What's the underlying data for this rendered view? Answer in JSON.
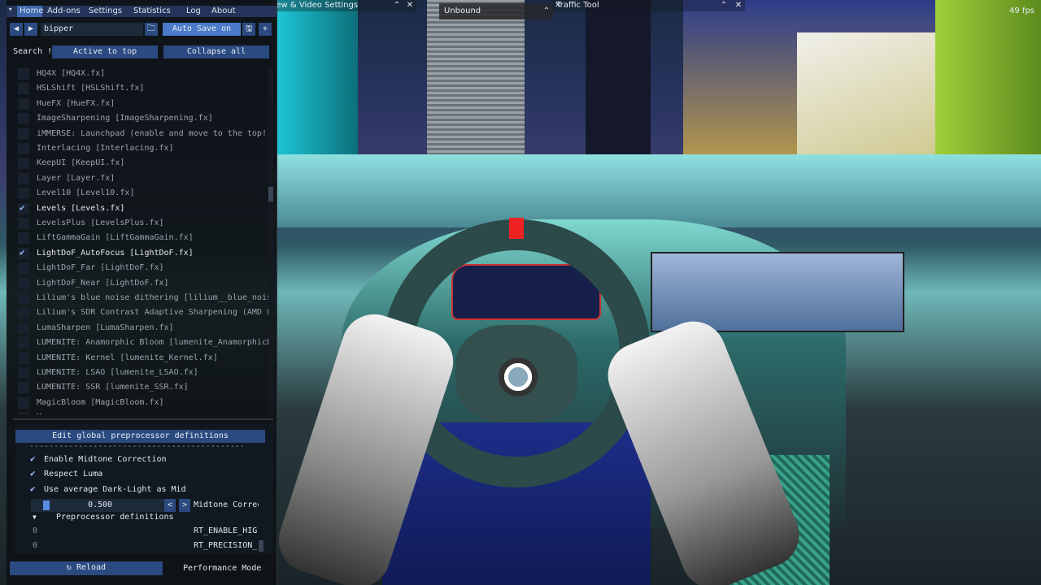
{
  "window": {
    "fps": "49 fps"
  },
  "overlays": {
    "view_video_settings": "View & Video Settings",
    "unbound": "Unbound",
    "traffic_tool": "Traffic Tool",
    "close": "✕",
    "collapse": "⌃"
  },
  "menubar": {
    "collapse_arrow": "▾",
    "items": [
      "Home",
      "Add-ons",
      "Settings",
      "Statistics",
      "Log",
      "About"
    ]
  },
  "toolbar": {
    "prev": "◀",
    "next": "▶",
    "preset_value": "bipper",
    "folder": "🗀",
    "auto_save": "Auto Save on",
    "save": "🖫",
    "add": "+"
  },
  "filter": {
    "search_label": "Search !",
    "active_to_top": "Active to top",
    "collapse_all": "Collapse all"
  },
  "effects": [
    {
      "label": "HQ4X [HQ4X.fx]",
      "checked": false
    },
    {
      "label": "HSLShift [HSLShift.fx]",
      "checked": false
    },
    {
      "label": "HueFX [HueFX.fx]",
      "checked": false
    },
    {
      "label": "ImageSharpening [ImageSharpening.fx]",
      "checked": false
    },
    {
      "label": "iMMERSE: Launchpad (enable and move to the top!) [M",
      "checked": false
    },
    {
      "label": "Interlacing [Interlacing.fx]",
      "checked": false
    },
    {
      "label": "KeepUI [KeepUI.fx]",
      "checked": false
    },
    {
      "label": "Layer [Layer.fx]",
      "checked": false
    },
    {
      "label": "Level10 [Level10.fx]",
      "checked": false
    },
    {
      "label": "Levels [Levels.fx]",
      "checked": true
    },
    {
      "label": "LevelsPlus [LevelsPlus.fx]",
      "checked": false
    },
    {
      "label": "LiftGammaGain [LiftGammaGain.fx]",
      "checked": false
    },
    {
      "label": "LightDoF_AutoFocus [LightDoF.fx]",
      "checked": true
    },
    {
      "label": "LightDoF_Far [LightDoF.fx]",
      "checked": false
    },
    {
      "label": "LightDoF_Near [LightDoF.fx]",
      "checked": false
    },
    {
      "label": "Lilium's blue noise dithering [lilium__blue_noise_d",
      "checked": false
    },
    {
      "label": "Lilium's SDR Contrast Adaptive Sharpening (AMD Fide",
      "checked": false
    },
    {
      "label": "LumaSharpen [LumaSharpen.fx]",
      "checked": false
    },
    {
      "label": "LUMENITE: Anamorphic Bloom [lumenite_AnamorphicBloo",
      "checked": false
    },
    {
      "label": "LUMENITE: Kernel [lumenite_Kernel.fx]",
      "checked": false
    },
    {
      "label": "LUMENITE: LSAO [lumenite_LSAO.fx]",
      "checked": false
    },
    {
      "label": "LUMENITE: SSR [lumenite_SSR.fx]",
      "checked": false
    },
    {
      "label": "MagicBloom [MagicBloom.fx]",
      "checked": false
    },
    {
      "label": "M...",
      "checked": false
    }
  ],
  "preprocessor": {
    "edit_button": "Edit global preprocessor definitions",
    "divider": "--------------------------------------------",
    "options": [
      {
        "label": "Enable Midtone Correction",
        "checked": true
      },
      {
        "label": "Respect Luma",
        "checked": true
      },
      {
        "label": "Use average Dark-Light as Mid",
        "checked": true
      }
    ],
    "slider_value": "0.500",
    "slider_fraction": 0.09,
    "dec": "<",
    "inc": ">",
    "slider_label": "Midtone Correc",
    "tree_arrow": "▼",
    "tree_label": "Preprocessor definitions",
    "defs": [
      {
        "value": "0",
        "name": "RT_ENABLE_HIGH"
      },
      {
        "value": "0",
        "name": "RT_PRECISION_L"
      }
    ]
  },
  "footer": {
    "reload": "↻ Reload",
    "performance_mode": "Performance Mode"
  }
}
